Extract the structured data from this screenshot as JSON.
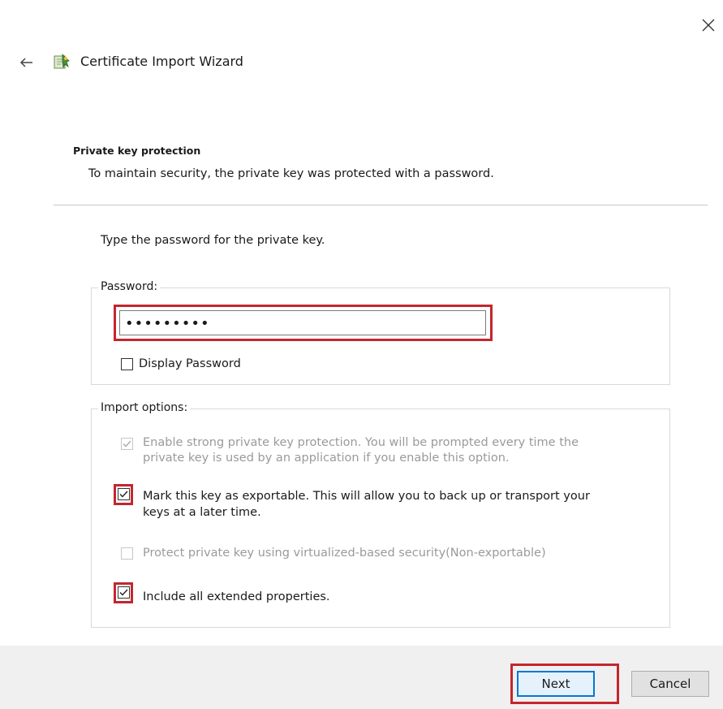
{
  "window": {
    "title": "Certificate Import Wizard",
    "close_icon": "close-icon",
    "back_icon": "back-arrow-icon",
    "wizard_icon": "certificate-icon"
  },
  "section": {
    "heading": "Private key protection",
    "description": "To maintain security, the private key was protected with a password."
  },
  "prompt": "Type the password for the private key.",
  "password_group": {
    "legend": "Password:",
    "password_value": "•••••••••",
    "display_password_label": "Display Password",
    "display_password_checked": false
  },
  "import_options": {
    "legend": "Import options:",
    "options": [
      {
        "line1": "Enable strong private key protection. You will be prompted every time the",
        "line2": "private key is used by an application if you enable this option.",
        "checked": true,
        "enabled": false
      },
      {
        "line1": "Mark this key as exportable. This will allow you to back up or transport your",
        "line2": "keys at a later time.",
        "checked": true,
        "enabled": true
      },
      {
        "line1": "Protect private key using virtualized-based security(Non-exportable)",
        "checked": false,
        "enabled": false
      },
      {
        "line1": "Include all extended properties.",
        "checked": true,
        "enabled": true
      }
    ]
  },
  "buttons": {
    "next": "Next",
    "cancel": "Cancel"
  },
  "colors": {
    "highlight": "#c4262e",
    "focus_border": "#0078d7",
    "footer_bg": "#f0f0f0"
  }
}
